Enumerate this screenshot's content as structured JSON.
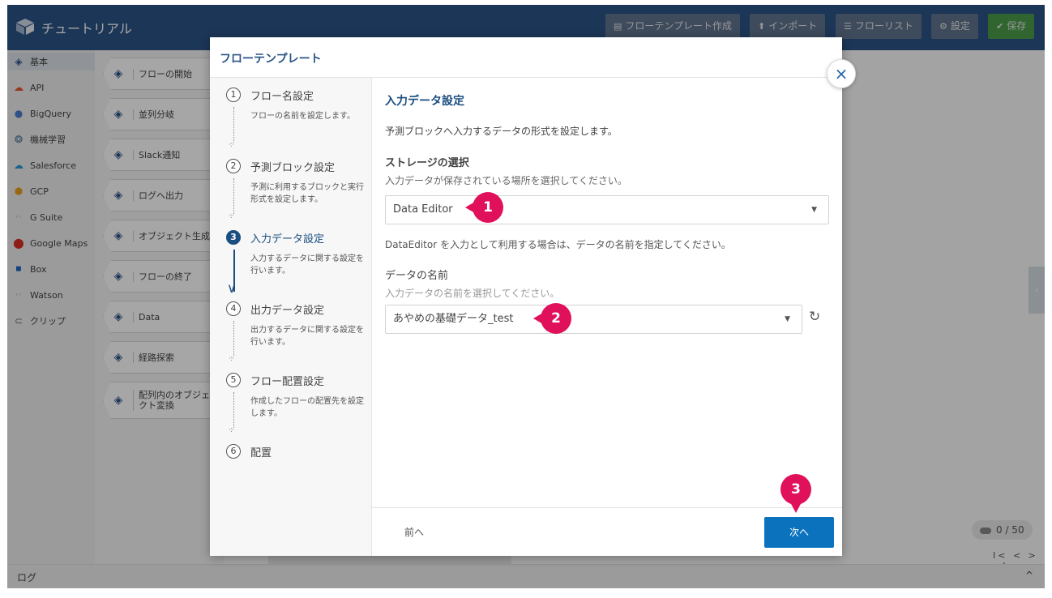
{
  "app": {
    "title": "チュートリアル",
    "logo_icon": "cube-logo-icon"
  },
  "header_buttons": [
    {
      "label": "フローテンプレート作成",
      "icon": "template-icon"
    },
    {
      "label": "インポート",
      "icon": "upload-icon"
    },
    {
      "label": "フローリスト",
      "icon": "list-icon"
    },
    {
      "label": "設定",
      "icon": "gear-icon"
    },
    {
      "label": "保存",
      "icon": "check-icon"
    }
  ],
  "sidebar": {
    "items": [
      {
        "label": "基本",
        "icon": "basic-icon"
      },
      {
        "label": "API",
        "icon": "api-icon"
      },
      {
        "label": "BigQuery",
        "icon": "bigquery-icon"
      },
      {
        "label": "機械学習",
        "icon": "ml-icon"
      },
      {
        "label": "Salesforce",
        "icon": "salesforce-icon"
      },
      {
        "label": "GCP",
        "icon": "gcp-icon"
      },
      {
        "label": "G Suite",
        "icon": "gsuite-icon"
      },
      {
        "label": "Google Maps",
        "icon": "map-pin-icon"
      },
      {
        "label": "Box",
        "icon": "box-icon"
      },
      {
        "label": "Watson",
        "icon": "watson-icon"
      },
      {
        "label": "クリップ",
        "icon": "clip-icon"
      }
    ]
  },
  "palette": {
    "blocks": [
      "フローの開始",
      "並列分岐",
      "Slack通知",
      "ログへ出力",
      "オブジェクト生成",
      "フローの終了",
      "Data",
      "経路探索",
      "配列内のオブジェクト変換"
    ]
  },
  "counter": "0 / 50",
  "pager": "I< < > >I",
  "log": {
    "label": "ログ",
    "toggle": "^"
  },
  "modal": {
    "title": "フローテンプレート",
    "close": "×",
    "steps": [
      {
        "num": "1",
        "title": "フロー名設定",
        "desc": "フローの名前を設定します。"
      },
      {
        "num": "2",
        "title": "予測ブロック設定",
        "desc": "予測に利用するブロックと実行形式を設定します。"
      },
      {
        "num": "3",
        "title": "入力データ設定",
        "desc": "入力するデータに関する設定を行います。"
      },
      {
        "num": "4",
        "title": "出力データ設定",
        "desc": "出力するデータに関する設定を行います。"
      },
      {
        "num": "5",
        "title": "フロー配置設定",
        "desc": "作成したフローの配置先を設定します。"
      },
      {
        "num": "6",
        "title": "配置",
        "desc": ""
      }
    ],
    "current_step": 3,
    "content": {
      "title": "入力データ設定",
      "desc": "予測ブロックへ入力するデータの形式を設定します。",
      "storage_label": "ストレージの選択",
      "storage_help": "入力データが保存されている場所を選択してください。",
      "storage_value": "Data Editor",
      "dataeditor_note": "DataEditor を入力として利用する場合は、データの名前を指定してください。",
      "name_label": "データの名前",
      "name_help": "入力データの名前を選択してください。",
      "name_value": "あやめの基礎データ_test"
    },
    "footer": {
      "prev": "前へ",
      "next": "次へ"
    }
  },
  "callouts": [
    "1",
    "2",
    "3"
  ],
  "colors": {
    "header": "#2b5486",
    "primary": "#0b72be",
    "callout": "#e0105b",
    "save": "#4a9b4a"
  }
}
